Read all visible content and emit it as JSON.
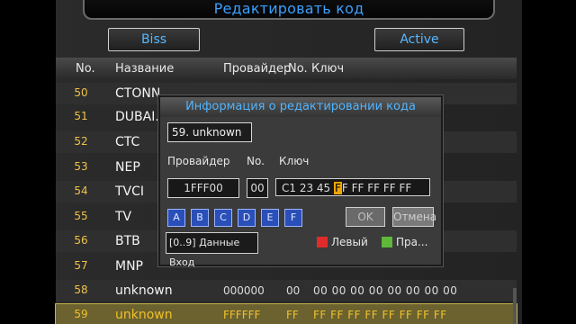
{
  "title": "Редактировать код",
  "top_buttons": {
    "biss": "Biss",
    "active": "Active"
  },
  "columns": {
    "no": "No.",
    "name": "Название",
    "provider": "Провайдер",
    "pno": "No.",
    "key": "Ключ"
  },
  "rows": [
    {
      "no": "50",
      "name": "CTONN...",
      "provider": "",
      "pno": "",
      "key": ""
    },
    {
      "no": "51",
      "name": "DUBAI...",
      "provider": "",
      "pno": "",
      "key": ""
    },
    {
      "no": "52",
      "name": "CTC",
      "provider": "",
      "pno": "",
      "key": ""
    },
    {
      "no": "53",
      "name": "NEP",
      "provider": "",
      "pno": "",
      "key": ""
    },
    {
      "no": "54",
      "name": "TVCI",
      "provider": "",
      "pno": "",
      "key": ""
    },
    {
      "no": "55",
      "name": "TV",
      "provider": "",
      "pno": "",
      "key": ""
    },
    {
      "no": "56",
      "name": "BTB",
      "provider": "",
      "pno": "",
      "key": ""
    },
    {
      "no": "57",
      "name": "MNP",
      "provider": "",
      "pno": "",
      "key": ""
    },
    {
      "no": "58",
      "name": "unknown",
      "provider": "000000",
      "pno": "00",
      "key": "00 00 00 00 00 00 00 00"
    },
    {
      "no": "59",
      "name": "unknown",
      "provider": "FFFFFF",
      "pno": "FF",
      "key": "FF FF FF FF FF FF FF FF"
    }
  ],
  "dialog": {
    "title": "Информация о редактировании кода",
    "channel": "59. unknown",
    "label_provider": "Провайдер",
    "label_no": "No.",
    "label_key": "Ключ",
    "provider_value": "1FFF00",
    "no_value": "00",
    "key_before": "C1 23 45 ",
    "key_cursor": "F",
    "key_after": "F FF FF FF FF",
    "hex_keys": [
      "A",
      "B",
      "C",
      "D",
      "E",
      "F"
    ],
    "ok": "OK",
    "cancel": "Отмена",
    "hint": "[0..9] Данные Вход",
    "legend_red": "Левый",
    "legend_green": "Пра..."
  },
  "colors": {
    "accent_blue": "#3aa0ff",
    "highlight": "#f0c12a",
    "red_key": "#e02b2b",
    "green_key": "#5fb83a"
  }
}
